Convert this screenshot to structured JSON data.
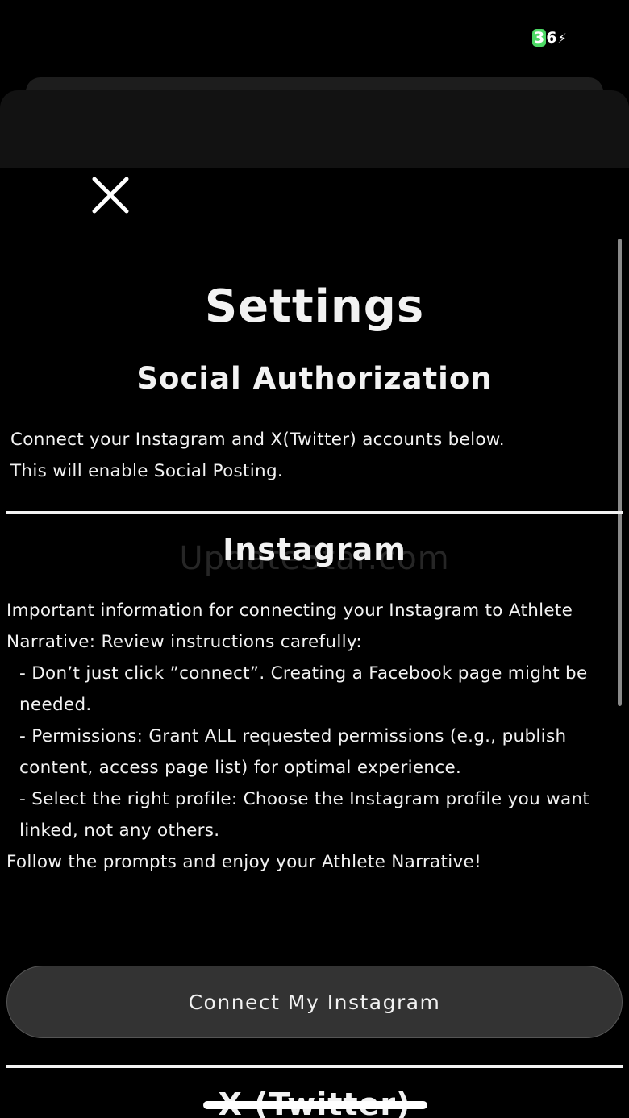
{
  "status_bar": {
    "battery_level": "36",
    "battery_first_digit": "3",
    "battery_rest": "6",
    "battery_color": "#4cd964"
  },
  "modal": {
    "close_icon": "close-x-icon",
    "title": "Settings",
    "subtitle": "Social Authorization",
    "intro_lines": [
      "Connect your Instagram and X(Twitter) accounts below.",
      "This will enable Social Posting."
    ],
    "instagram": {
      "heading": "Instagram",
      "info_intro": "Important information for connecting your Instagram to Athlete Narrative: Review instructions carefully:",
      "bullets": [
        "- Don’t just click ”connect”. Creating a Facebook page might be needed.",
        "- Permissions: Grant ALL requested permissions (e.g., publish content, access page list) for optimal experience.",
        "- Select the right profile: Choose the Instagram profile you want linked, not any others."
      ],
      "info_outro": "Follow the prompts and enjoy your Athlete Narrative!",
      "connect_label": "Connect My Instagram"
    },
    "x_twitter": {
      "heading": "X (Twitter)"
    }
  },
  "watermark": "UpdateStar.com"
}
